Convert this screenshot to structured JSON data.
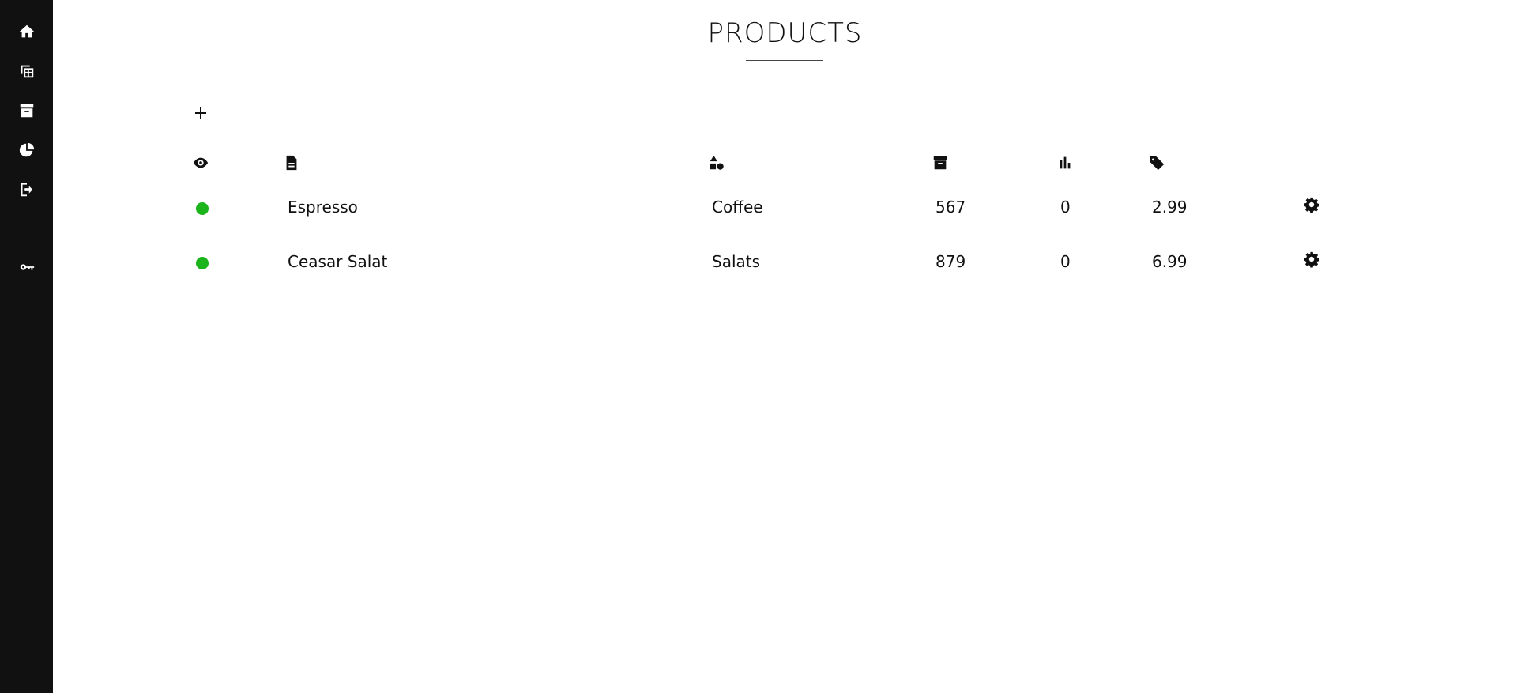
{
  "sidebar": {
    "items": [
      {
        "icon": "home-icon"
      },
      {
        "icon": "table-icon"
      },
      {
        "icon": "archive-icon"
      },
      {
        "icon": "pie-chart-icon"
      },
      {
        "icon": "logout-icon"
      },
      {
        "icon": "key-icon"
      }
    ]
  },
  "page": {
    "title": "PRODUCTS",
    "add_icon": "plus-icon"
  },
  "table": {
    "header_icons": [
      "eye-icon",
      "file-icon",
      "shapes-icon",
      "archive-icon",
      "bar-chart-icon",
      "tag-icon"
    ],
    "rows": [
      {
        "status": "active",
        "status_color": "#1bb41b",
        "name": "Espresso",
        "category": "Coffee",
        "stock": "567",
        "sold": "0",
        "price": "2.99",
        "action_icon": "gear-icon"
      },
      {
        "status": "active",
        "status_color": "#1bb41b",
        "name": "Ceasar Salat",
        "category": "Salats",
        "stock": "879",
        "sold": "0",
        "price": "6.99",
        "action_icon": "gear-icon"
      }
    ]
  },
  "colors": {
    "sidebar_bg": "#111111",
    "status_active": "#1bb41b"
  }
}
